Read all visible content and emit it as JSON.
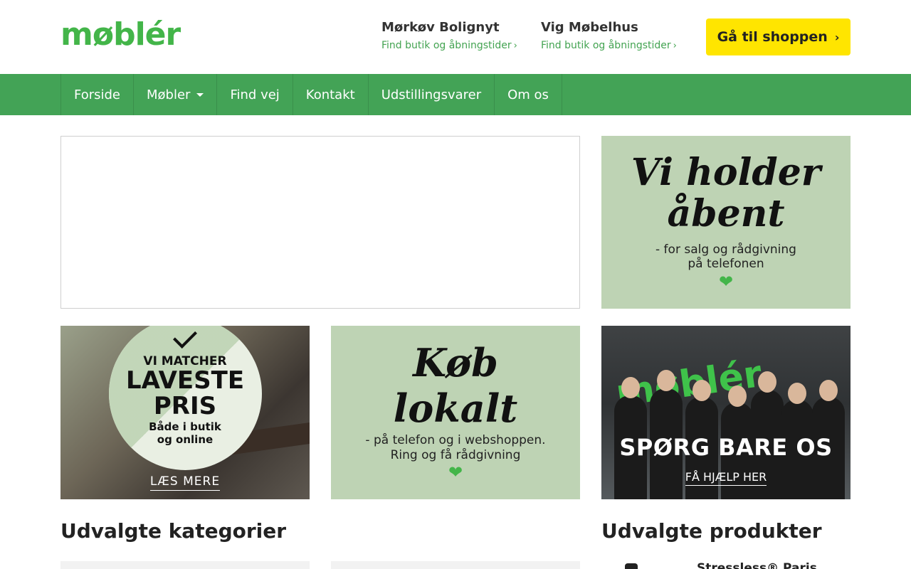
{
  "header": {
    "logo_text": "møblér",
    "stores": [
      {
        "name": "Mørkøv Bolignyt",
        "link": "Find butik og åbningstider"
      },
      {
        "name": "Vig Møbelhus",
        "link": "Find butik og åbningstider"
      }
    ],
    "shop_button": "Gå til shoppen",
    "chevron": "›"
  },
  "nav": {
    "items": [
      "Forside",
      "Møbler",
      "Find vej",
      "Kontakt",
      "Udstillingsvarer",
      "Om os"
    ]
  },
  "banners": {
    "open": {
      "line1": "Vi holder",
      "line2": "åbent",
      "sub1": "- for salg og rådgivning",
      "sub2": "på telefonen",
      "heart": "❤"
    },
    "match": {
      "line1": "VI MATCHER",
      "line2": "LAVESTE",
      "line3": "PRIS",
      "line4": "Både i butik",
      "line5": "og online",
      "link": "LÆS MERE"
    },
    "local": {
      "line1": "Køb",
      "line2": "lokalt",
      "sub1": "- på telefon og i webshoppen.",
      "sub2": "Ring og få rådgivning",
      "heart": "❤"
    },
    "ask": {
      "logo": "møblér",
      "title": "SPØRG BARE OS",
      "link": "FÅ HJÆLP HER"
    }
  },
  "sections": {
    "categories_title": "Udvalgte kategorier",
    "products_title": "Udvalgte produkter",
    "first_product": "Stressless® Paris"
  },
  "colors": {
    "brand_green": "#43a356",
    "logo_green": "#43b549",
    "button_yellow": "#ffe500",
    "tile_green": "#bed3b4"
  }
}
